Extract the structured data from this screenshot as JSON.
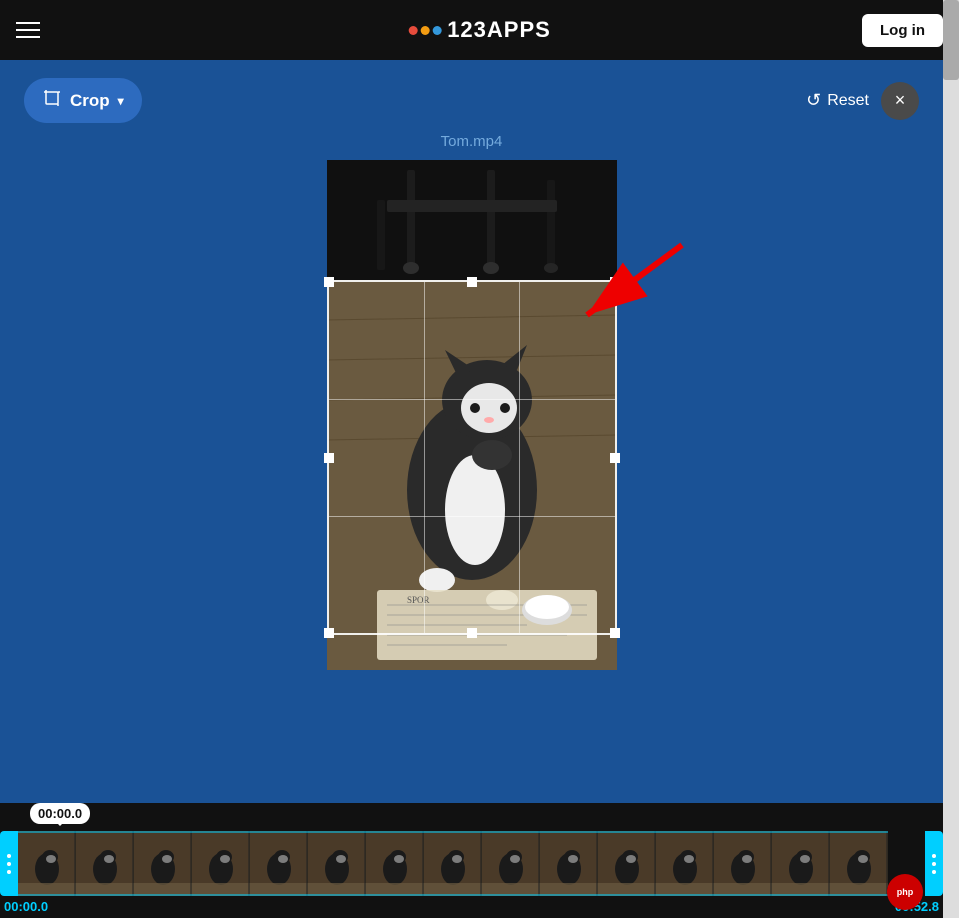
{
  "navbar": {
    "logo_text": "123APPS",
    "login_label": "Log in"
  },
  "toolbar": {
    "crop_label": "Crop",
    "reset_label": "Reset",
    "close_label": "×"
  },
  "file": {
    "name": "Tom.mp4"
  },
  "timeline": {
    "start_time": "00:00.0",
    "end_time": "00:52.8",
    "tooltip_time": "00:00.0"
  },
  "icons": {
    "hamburger": "☰",
    "crop": "⊡",
    "dropdown": "▾",
    "reset": "↺",
    "close": "✕",
    "handle_dots": "⋮"
  }
}
